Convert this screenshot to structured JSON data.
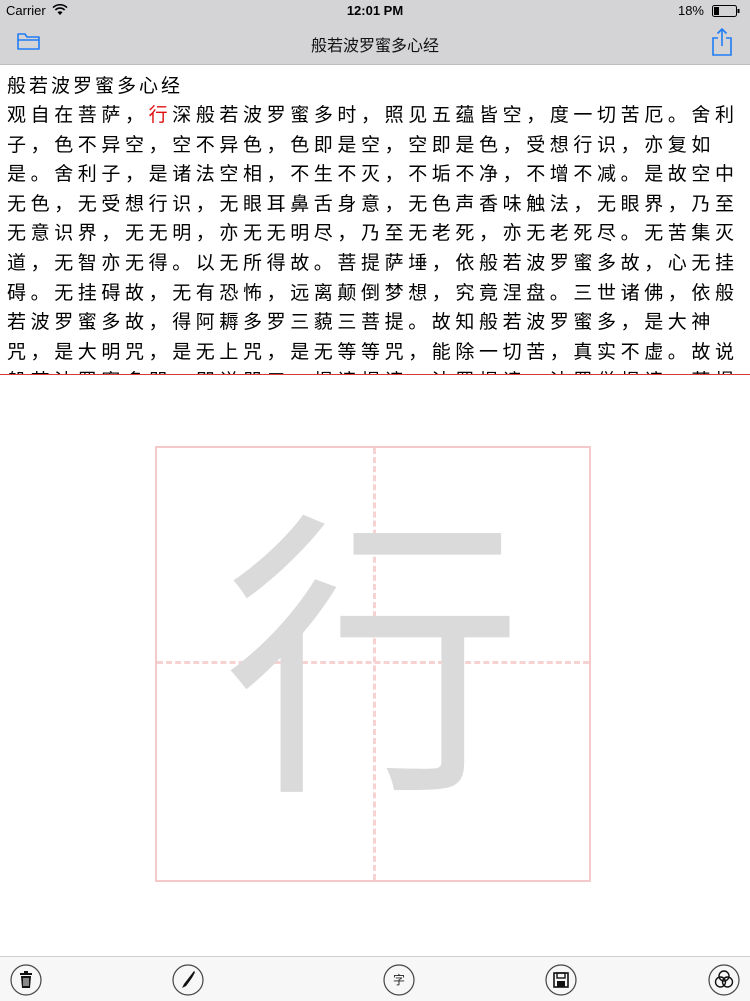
{
  "status_bar": {
    "carrier": "Carrier",
    "time": "12:01 PM",
    "battery": "18%"
  },
  "nav": {
    "title": "般若波罗蜜多心经",
    "left_icon": "folder-icon",
    "right_icon": "share-icon"
  },
  "document": {
    "heading": "般若波罗蜜多心经",
    "text_before": "观自在菩萨，",
    "highlight": "行",
    "text_after": "深般若波罗蜜多时，照见五蕴皆空，度一切苦厄。舍利子，色不异空，空不异色，色即是空，空即是色，受想行识，亦复如是。舍利子，是诸法空相，不生不灭，不垢不净，不增不减。是故空中无色，无受想行识，无眼耳鼻舌身意，无色声香味触法，无眼界，乃至无意识界，无无明，亦无无明尽，乃至无老死，亦无老死尽。无苦集灭道，无智亦无得。以无所得故。菩提萨埵，依般若波罗蜜多故，心无挂碍。无挂碍故，无有恐怖，远离颠倒梦想，究竟涅盘。三世诸佛，依般若波罗蜜多故，得阿耨多罗三藐三菩提。故知般若波罗蜜多，是大神咒，是大明咒，是无上咒，是无等等咒，能除一切苦，真实不虚。故说般若波罗蜜多咒，即说咒曰：揭谛揭谛，波罗揭谛，波罗僧揭谛，菩提萨婆诃。"
  },
  "practice": {
    "character": "行",
    "grid_color": "#f3c9c9",
    "trace_color": "#dadada"
  },
  "toolbar": {
    "trash_icon": "trash-icon",
    "brush_icon": "brush-icon",
    "char_label": "字",
    "save_icon": "save-icon",
    "settings_icon": "color-circles-icon"
  },
  "colors": {
    "bar_background": "#d4d4d6",
    "accent": "#1f7cf5",
    "highlight": "#e01010"
  }
}
